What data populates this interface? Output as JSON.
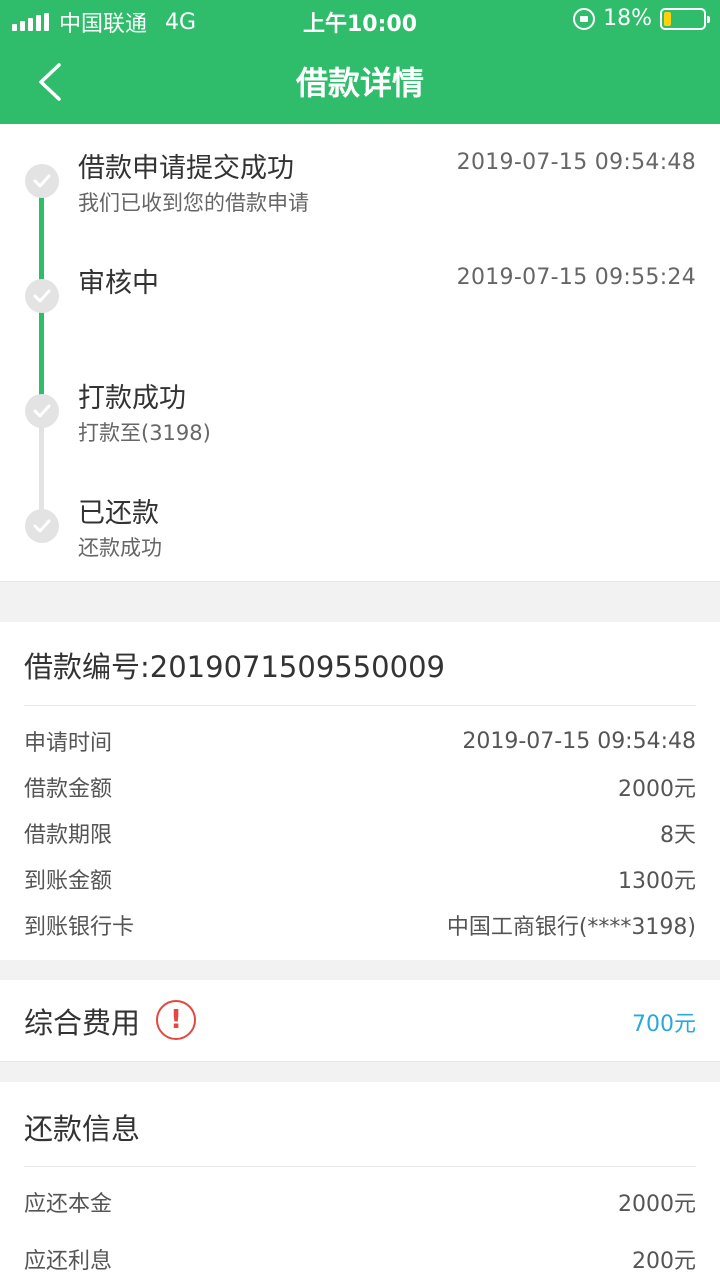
{
  "status_bar": {
    "carrier": "中国联通",
    "network": "4G",
    "time": "上午10:00",
    "battery_text": "18%",
    "battery_level": 0.18
  },
  "nav": {
    "title": "借款详情",
    "back_icon": "chevron-left-icon"
  },
  "timeline": [
    {
      "title": "借款申请提交成功",
      "subtitle": "我们已收到您的借款申请",
      "time": "2019-07-15 09:54:48",
      "done": true
    },
    {
      "title": "审核中",
      "subtitle": "",
      "time": "2019-07-15 09:55:24",
      "done": true
    },
    {
      "title": "打款成功",
      "subtitle": "打款至(3198)",
      "time": "",
      "done": true
    },
    {
      "title": "已还款",
      "subtitle": "还款成功",
      "time": "",
      "done": false
    }
  ],
  "loan": {
    "number_text": "借款编号:2019071509550009",
    "rows": [
      {
        "label": "申请时间",
        "value": "2019-07-15 09:54:48"
      },
      {
        "label": "借款金额",
        "value": "2000元"
      },
      {
        "label": "借款期限",
        "value": "8天"
      },
      {
        "label": "到账金额",
        "value": "1300元"
      },
      {
        "label": "到账银行卡",
        "value": "中国工商银行(****3198)"
      }
    ]
  },
  "fee": {
    "label": "综合费用",
    "icon_glyph": "!",
    "value": "700元"
  },
  "repayment": {
    "title": "还款信息",
    "rows": [
      {
        "label": "应还本金",
        "value": "2000元"
      },
      {
        "label": "应还利息",
        "value": "200元"
      }
    ]
  },
  "colors": {
    "primary_green": "#2fbd6c",
    "timeline_inactive": "#e3e3e3",
    "fee_value_blue": "#28a8df",
    "warning_red": "#e4473f",
    "battery_yellow": "#ffd10a"
  }
}
